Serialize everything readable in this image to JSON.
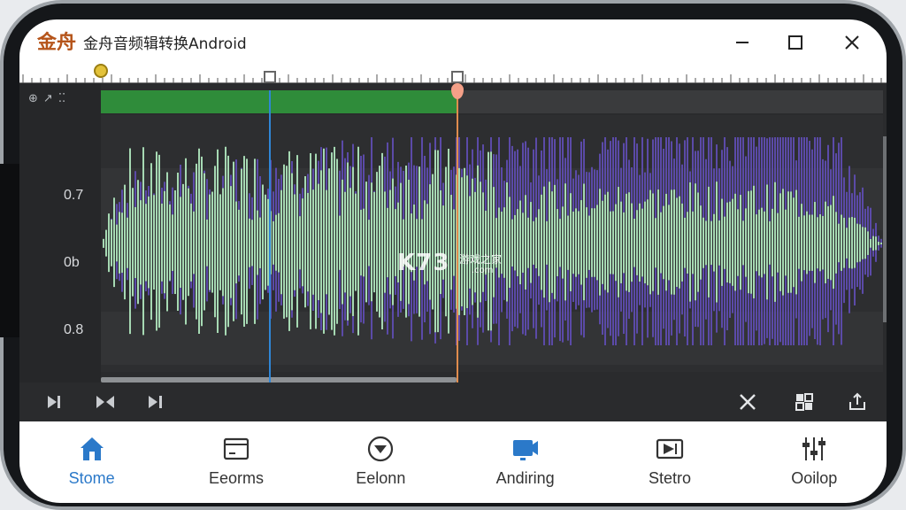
{
  "app": {
    "logo_text": "金舟",
    "title": "金舟音频辑转换Android"
  },
  "window_controls": {
    "minimize": "minimize-icon",
    "maximize": "maximize-icon",
    "close": "close-icon"
  },
  "editor": {
    "y_labels": [
      "0.7",
      "0b",
      "0.8"
    ],
    "colors": {
      "selection": "#2f8c3a",
      "wave_primary": "#a6d9b3",
      "wave_secondary": "#5b4aa8",
      "playhead": "#2f86d6",
      "marker": "#e08c4d"
    }
  },
  "transport": {
    "buttons": [
      "skip-end-icon",
      "trim-icon",
      "skip-start-icon"
    ],
    "right_buttons": [
      "shuffle-icon",
      "grid-icon",
      "export-icon"
    ]
  },
  "watermark": {
    "brand": "K73",
    "site": "游戏之家",
    "domain": ".com"
  },
  "bottom_nav": {
    "items": [
      {
        "label": "Stome",
        "icon": "home-icon"
      },
      {
        "label": "Eeorms",
        "icon": "window-icon"
      },
      {
        "label": "Eelonn",
        "icon": "download-circle-icon"
      },
      {
        "label": "Andiring",
        "icon": "video-icon"
      },
      {
        "label": "Stetro",
        "icon": "filter-icon"
      },
      {
        "label": "Ooilop",
        "icon": "sliders-icon"
      }
    ]
  }
}
